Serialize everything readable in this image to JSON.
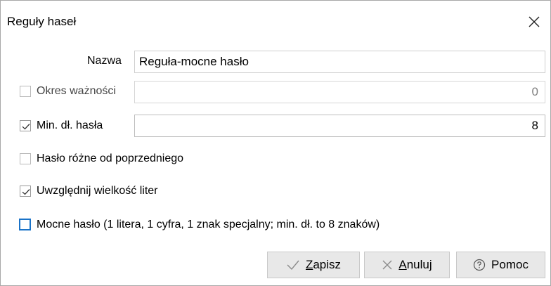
{
  "dialog": {
    "title": "Reguły haseł"
  },
  "name_field": {
    "label": "Nazwa",
    "value": "Reguła-mocne hasło"
  },
  "validity": {
    "label": "Okres ważności",
    "checked": false,
    "value": "0"
  },
  "min_length": {
    "label": "Min. dł. hasła",
    "checked": true,
    "value": "8"
  },
  "diff_previous": {
    "label": "Hasło różne od poprzedniego",
    "checked": false
  },
  "case_sensitive": {
    "label": "Uwzględnij wielkość liter",
    "checked": true
  },
  "strong_password": {
    "label": "Mocne hasło (1 litera, 1 cyfra, 1 znak specjalny; min. dł. to 8 znaków)",
    "checked": false,
    "focused": true
  },
  "buttons": {
    "save": {
      "accel": "Z",
      "rest": "apisz",
      "icon": "checkmark-icon"
    },
    "cancel": {
      "accel": "A",
      "rest": "nuluj",
      "icon": "x-icon"
    },
    "help": {
      "label": "Pomoc",
      "icon": "question-circle-icon"
    }
  },
  "colors": {
    "focus": "#1a73c8",
    "button_bg": "#e8e8e8",
    "icon_gray": "#8a8a8a"
  }
}
